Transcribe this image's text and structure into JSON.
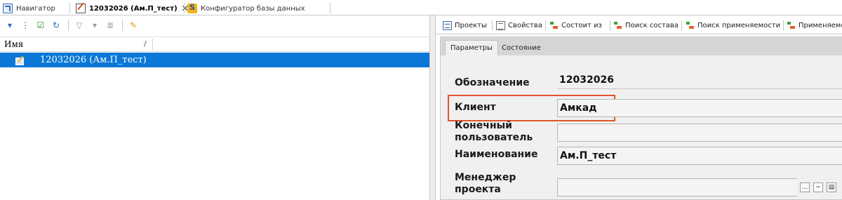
{
  "doc_tabs": [
    {
      "label": "Навигатор",
      "icon": "navigator-icon"
    },
    {
      "label": "12032026 (Ам.П_тест)",
      "icon": "document-edit-icon",
      "active": true
    },
    {
      "label": "Конфигуратор базы данных",
      "icon": "database-configurator-icon"
    }
  ],
  "left_pane": {
    "toolbar_icons": [
      "expand-all-icon",
      "collapse-tree-icon",
      "checkbox-icon",
      "refresh-icon",
      "filter-icon",
      "filter-dropdown-icon",
      "filter-list-icon",
      "edit-pencil-icon"
    ],
    "column_header": "Имя",
    "sort_indicator": "/",
    "tree_item": "12032026 (Ам.П_тест)"
  },
  "right_tabs": [
    {
      "label": "Проекты",
      "icon": "projects-icon"
    },
    {
      "label": "Свойства",
      "icon": "properties-icon"
    },
    {
      "label": "Состоит из",
      "icon": "tree-structure-icon"
    },
    {
      "label": "Поиск состава",
      "icon": "tree-structure-icon"
    },
    {
      "label": "Поиск применяемости",
      "icon": "tree-structure-icon"
    },
    {
      "label": "Применяемо",
      "icon": "tree-structure-icon"
    }
  ],
  "sub_tabs": [
    "Параметры",
    "Состояние"
  ],
  "fields": {
    "designation": {
      "label": "Обозначение",
      "value": "12032026"
    },
    "client": {
      "label": "Клиент",
      "value": "Амкад"
    },
    "end_user": {
      "label_line1": "Конечный",
      "label_line2": "пользователь",
      "value": ""
    },
    "name": {
      "label": "Наименование",
      "value": "Ам.П_тест"
    },
    "manager": {
      "label_line1": "Менеджер",
      "label_line2": "проекта",
      "value": ""
    }
  },
  "ellipsis_label": "...",
  "colors": {
    "selection": "#0b78d7",
    "highlight_border": "#e0552a"
  }
}
